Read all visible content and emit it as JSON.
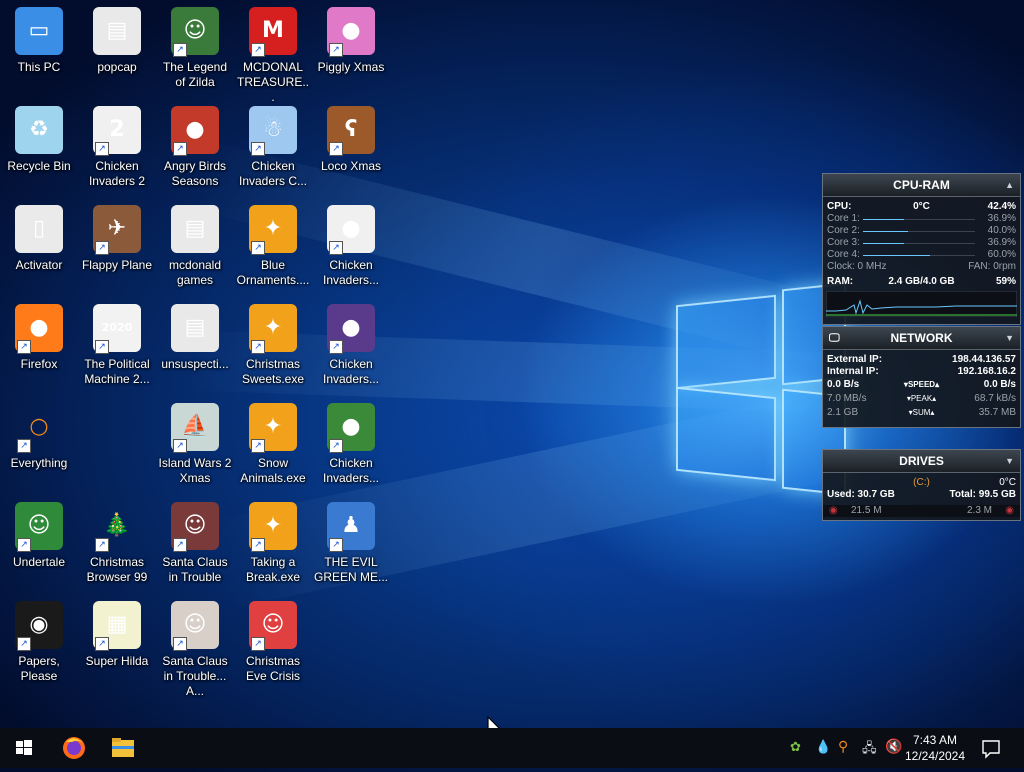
{
  "desktop_icons": [
    {
      "label": "This PC",
      "icon": "computer-icon",
      "bg": "#3a8ee6",
      "glyph": "▭",
      "shortcut": false
    },
    {
      "label": "popcap",
      "icon": "folder-icon",
      "bg": "#e9e9e9",
      "glyph": "▤",
      "shortcut": false
    },
    {
      "label": "The Legend of Zilda",
      "icon": "game-legend-icon",
      "bg": "#3a7a3a",
      "glyph": "☺",
      "shortcut": true
    },
    {
      "label": "MCDONAL TREASURE...",
      "icon": "mcdonalds-icon",
      "bg": "#d61f1f",
      "glyph": "M",
      "shortcut": true
    },
    {
      "label": "Piggly Xmas",
      "icon": "piggy-icon",
      "bg": "#e07ac8",
      "glyph": "●",
      "shortcut": true
    },
    {
      "label": "Recycle Bin",
      "icon": "recycle-bin-icon",
      "bg": "#9fd4ee",
      "glyph": "♻",
      "shortcut": false
    },
    {
      "label": "Chicken Invaders 2",
      "icon": "chicken-icon",
      "bg": "#f0f0f0",
      "glyph": "2",
      "shortcut": true
    },
    {
      "label": "Angry Birds Seasons",
      "icon": "angry-birds-icon",
      "bg": "#c43a2a",
      "glyph": "●",
      "shortcut": true
    },
    {
      "label": "Chicken Invaders C...",
      "icon": "snowman-icon",
      "bg": "#9ec8f0",
      "glyph": "☃",
      "shortcut": true
    },
    {
      "label": "Loco Xmas",
      "icon": "bear-icon",
      "bg": "#9c5a2a",
      "glyph": "ʕ",
      "shortcut": true
    },
    {
      "label": "Activator",
      "icon": "file-icon",
      "bg": "#eaeaea",
      "glyph": "▯",
      "shortcut": false
    },
    {
      "label": "Flappy Plane",
      "icon": "plane-icon",
      "bg": "#8a5a3a",
      "glyph": "✈",
      "shortcut": true
    },
    {
      "label": "mcdonald games",
      "icon": "folder-icon",
      "bg": "#e9e9e9",
      "glyph": "▤",
      "shortcut": false
    },
    {
      "label": "Blue Ornaments....",
      "icon": "puzzle-icon",
      "bg": "#f2a21a",
      "glyph": "✦",
      "shortcut": true
    },
    {
      "label": "Chicken Invaders...",
      "icon": "chicken-icon",
      "bg": "#f0f0f0",
      "glyph": "●",
      "shortcut": true
    },
    {
      "label": "Firefox",
      "icon": "firefox-icon",
      "bg": "#ff7a18",
      "glyph": "●",
      "shortcut": true
    },
    {
      "label": "The Political Machine 2...",
      "icon": "political-icon",
      "bg": "#f2f2f2",
      "glyph": "2020",
      "shortcut": true
    },
    {
      "label": "unsuspecti...",
      "icon": "folder-icon",
      "bg": "#e9e9e9",
      "glyph": "▤",
      "shortcut": false
    },
    {
      "label": "Christmas Sweets.exe",
      "icon": "puzzle-icon",
      "bg": "#f2a21a",
      "glyph": "✦",
      "shortcut": true
    },
    {
      "label": "Chicken Invaders...",
      "icon": "chicken-icon",
      "bg": "#5a3a8a",
      "glyph": "●",
      "shortcut": true
    },
    {
      "label": "Everything",
      "icon": "search-icon",
      "bg": "transparent",
      "glyph": "○",
      "shortcut": true
    },
    {
      "label": "",
      "icon": "",
      "bg": "",
      "glyph": "",
      "shortcut": false
    },
    {
      "label": "Island Wars 2 Xmas",
      "icon": "island-icon",
      "bg": "#c9d8d4",
      "glyph": "⛵",
      "shortcut": true
    },
    {
      "label": "Snow Animals.exe",
      "icon": "puzzle-icon",
      "bg": "#f2a21a",
      "glyph": "✦",
      "shortcut": true
    },
    {
      "label": "Chicken Invaders...",
      "icon": "chicken-icon",
      "bg": "#3a8a3a",
      "glyph": "●",
      "shortcut": true
    },
    {
      "label": "Undertale",
      "icon": "undertale-icon",
      "bg": "#2f8a3a",
      "glyph": "☺",
      "shortcut": true
    },
    {
      "label": "Christmas Browser 99",
      "icon": "tree-icon",
      "bg": "transparent",
      "glyph": "🎄",
      "shortcut": true
    },
    {
      "label": "Santa Claus in Trouble",
      "icon": "santa-icon",
      "bg": "#7a3a3a",
      "glyph": "☺",
      "shortcut": true
    },
    {
      "label": "Taking a Break.exe",
      "icon": "puzzle-icon",
      "bg": "#f2a21a",
      "glyph": "✦",
      "shortcut": true
    },
    {
      "label": "THE EVIL GREEN ME...",
      "icon": "messenger-icon",
      "bg": "#3a7ad0",
      "glyph": "♟",
      "shortcut": true
    },
    {
      "label": "Papers, Please",
      "icon": "papers-please-icon",
      "bg": "#1a1a1a",
      "glyph": "◉",
      "shortcut": true
    },
    {
      "label": "Super Hilda",
      "icon": "hilda-icon",
      "bg": "#f2f2d0",
      "glyph": "▦",
      "shortcut": true
    },
    {
      "label": "Santa Claus in Trouble... A...",
      "icon": "santa-icon",
      "bg": "#d8d0c8",
      "glyph": "☺",
      "shortcut": true
    },
    {
      "label": "Christmas Eve Crisis",
      "icon": "santa-face-icon",
      "bg": "#e04040",
      "glyph": "☺",
      "shortcut": true
    }
  ],
  "cpu_ram": {
    "title": "CPU-RAM",
    "cpu_label": "CPU:",
    "cpu_temp": "0°C",
    "cpu_value": "42.4%",
    "cores": [
      {
        "label": "Core 1:",
        "value": "36.9%",
        "fraction": 0.369
      },
      {
        "label": "Core 2:",
        "value": "40.0%",
        "fraction": 0.4
      },
      {
        "label": "Core 3:",
        "value": "36.9%",
        "fraction": 0.369
      },
      {
        "label": "Core 4:",
        "value": "60.0%",
        "fraction": 0.6
      }
    ],
    "clock": "Clock: 0 MHz",
    "fan": "FAN: 0rpm",
    "ram_label": "RAM:",
    "ram_usage": "2.4 GB/4.0 GB",
    "ram_percent": "59%"
  },
  "network": {
    "title": "NETWORK",
    "external_ip_label": "External IP:",
    "external_ip": "198.44.136.57",
    "internal_ip_label": "Internal IP:",
    "internal_ip": "192.168.16.2",
    "speed_left": "0.0 B/s",
    "speed_label": "SPEED",
    "speed_right": "0.0 B/s",
    "peak_left": "7.0 MB/s",
    "peak_label": "PEAK",
    "peak_right": "68.7 kB/s",
    "sum_left": "2.1 GB",
    "sum_label": "SUM",
    "sum_right": "35.7 MB"
  },
  "drives": {
    "title": "DRIVES",
    "drive_label": "(C:)",
    "drive_temp": "0°C",
    "used": "Used: 30.7 GB",
    "total": "Total: 99.5 GB",
    "read": "21.5 M",
    "write": "2.3 M"
  },
  "taskbar": {
    "clock_time": "7:43 AM",
    "clock_date": "12/24/2024"
  },
  "colors": {
    "accent": "#0a4aa8",
    "gadget_bg": "#14181e",
    "taskbar": "#0a0d14"
  }
}
